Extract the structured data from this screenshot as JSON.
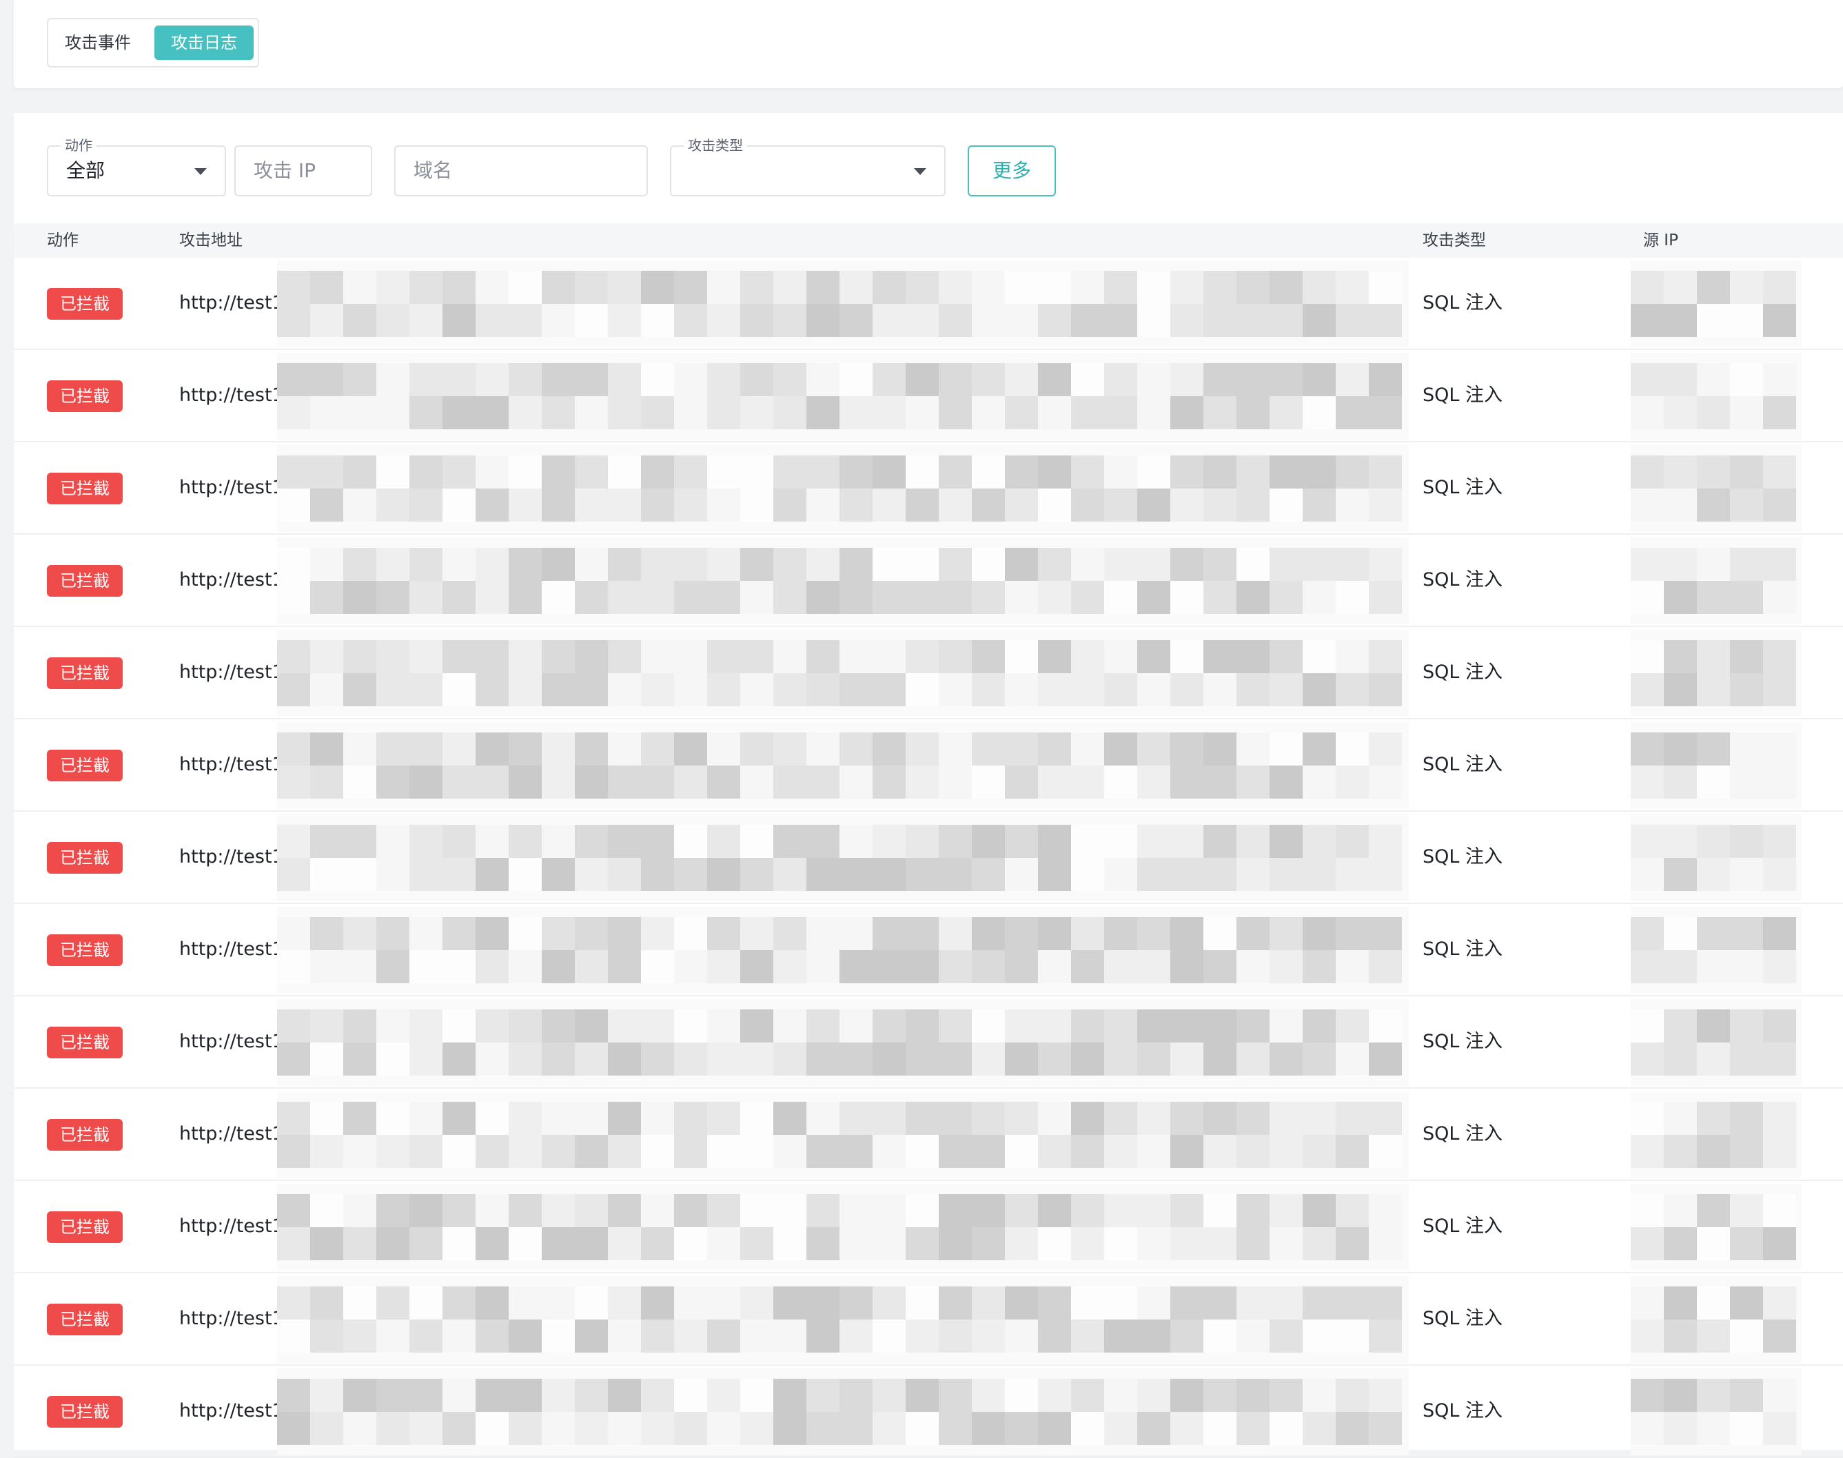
{
  "tabs": [
    {
      "label": "攻击事件",
      "active": false
    },
    {
      "label": "攻击日志",
      "active": true
    }
  ],
  "filters": {
    "action": {
      "label": "动作",
      "value": "全部"
    },
    "attack_ip": {
      "placeholder": "攻击 IP"
    },
    "domain": {
      "placeholder": "域名"
    },
    "attack_type": {
      "label": "攻击类型",
      "value": ""
    },
    "more_label": "更多"
  },
  "table": {
    "headers": {
      "action": "动作",
      "address": "攻击地址",
      "type": "攻击类型",
      "source_ip": "源 IP"
    },
    "rows": [
      {
        "action": "已拦截",
        "address": "http://test1",
        "type": "SQL 注入"
      },
      {
        "action": "已拦截",
        "address": "http://test1",
        "type": "SQL 注入"
      },
      {
        "action": "已拦截",
        "address": "http://test1",
        "type": "SQL 注入"
      },
      {
        "action": "已拦截",
        "address": "http://test1",
        "type": "SQL 注入"
      },
      {
        "action": "已拦截",
        "address": "http://test1",
        "type": "SQL 注入"
      },
      {
        "action": "已拦截",
        "address": "http://test1",
        "type": "SQL 注入"
      },
      {
        "action": "已拦截",
        "address": "http://test1",
        "type": "SQL 注入"
      },
      {
        "action": "已拦截",
        "address": "http://test1",
        "type": "SQL 注入"
      },
      {
        "action": "已拦截",
        "address": "http://test1",
        "type": "SQL 注入"
      },
      {
        "action": "已拦截",
        "address": "http://test1",
        "type": "SQL 注入"
      },
      {
        "action": "已拦截",
        "address": "http://test1",
        "type": "SQL 注入"
      },
      {
        "action": "已拦截",
        "address": "http://test1",
        "type": "SQL 注入"
      },
      {
        "action": "已拦截",
        "address": "http://test1",
        "type": "SQL 注入"
      }
    ]
  },
  "colors": {
    "accent": "#46c0c0",
    "blocked_badge": "#f04b4b",
    "header_bg": "#f5f6f8"
  }
}
